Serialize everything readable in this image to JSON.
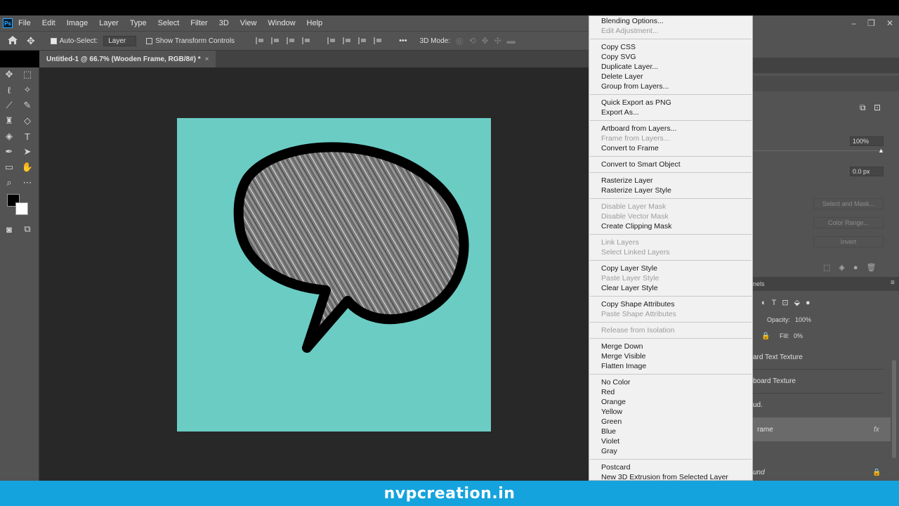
{
  "app": {
    "logo": "Ps"
  },
  "menu": [
    "File",
    "Edit",
    "Image",
    "Layer",
    "Type",
    "Select",
    "Filter",
    "3D",
    "View",
    "Window",
    "Help"
  ],
  "options": {
    "auto_select_label": "Auto-Select:",
    "auto_select_value": "Layer",
    "transform_label": "Show Transform Controls",
    "mode_3d_label": "3D Mode:",
    "more": "•••"
  },
  "document": {
    "tab_title": "Untitled-1 @ 66.7% (Wooden Frame, RGB/8#) *",
    "close": "×",
    "canvas_color": "#6bccc4"
  },
  "properties": {
    "density": "100%",
    "feather": "0.0 px",
    "select_mask_btn": "Select and Mask...",
    "color_range_btn": "Color Range...",
    "invert_btn": "Invert"
  },
  "layers": {
    "panel_title": "nels",
    "opacity_label": "Opacity:",
    "opacity_value": "100%",
    "fill_label": "Fill:",
    "fill_value": "0%",
    "rows": [
      {
        "name": "ard Text Texture"
      },
      {
        "name": "board Texture"
      },
      {
        "name": "ud."
      },
      {
        "name": "rame",
        "fx": "fx"
      },
      {
        "name": "und"
      }
    ]
  },
  "context_menu": {
    "items": [
      {
        "label": "Blending Options...",
        "disabled": false
      },
      {
        "label": "Edit Adjustment...",
        "disabled": true
      },
      {
        "sep": true
      },
      {
        "label": "Copy CSS",
        "disabled": false
      },
      {
        "label": "Copy SVG",
        "disabled": false
      },
      {
        "label": "Duplicate Layer...",
        "disabled": false
      },
      {
        "label": "Delete Layer",
        "disabled": false
      },
      {
        "label": "Group from Layers...",
        "disabled": false
      },
      {
        "sep": true
      },
      {
        "label": "Quick Export as PNG",
        "disabled": false
      },
      {
        "label": "Export As...",
        "disabled": false
      },
      {
        "sep": true
      },
      {
        "label": "Artboard from Layers...",
        "disabled": false
      },
      {
        "label": "Frame from Layers...",
        "disabled": true
      },
      {
        "label": "Convert to Frame",
        "disabled": false
      },
      {
        "sep": true
      },
      {
        "label": "Convert to Smart Object",
        "disabled": false
      },
      {
        "sep": true
      },
      {
        "label": "Rasterize Layer",
        "disabled": false
      },
      {
        "label": "Rasterize Layer Style",
        "disabled": false
      },
      {
        "sep": true
      },
      {
        "label": "Disable Layer Mask",
        "disabled": true
      },
      {
        "label": "Disable Vector Mask",
        "disabled": true
      },
      {
        "label": "Create Clipping Mask",
        "disabled": false
      },
      {
        "sep": true
      },
      {
        "label": "Link Layers",
        "disabled": true
      },
      {
        "label": "Select Linked Layers",
        "disabled": true
      },
      {
        "sep": true
      },
      {
        "label": "Copy Layer Style",
        "disabled": false
      },
      {
        "label": "Paste Layer Style",
        "disabled": true
      },
      {
        "label": "Clear Layer Style",
        "disabled": false
      },
      {
        "sep": true
      },
      {
        "label": "Copy Shape Attributes",
        "disabled": false
      },
      {
        "label": "Paste Shape Attributes",
        "disabled": true
      },
      {
        "sep": true
      },
      {
        "label": "Release from Isolation",
        "disabled": true
      },
      {
        "sep": true
      },
      {
        "label": "Merge Down",
        "disabled": false
      },
      {
        "label": "Merge Visible",
        "disabled": false
      },
      {
        "label": "Flatten Image",
        "disabled": false
      },
      {
        "sep": true
      },
      {
        "label": "No Color",
        "disabled": false
      },
      {
        "label": "Red",
        "disabled": false
      },
      {
        "label": "Orange",
        "disabled": false
      },
      {
        "label": "Yellow",
        "disabled": false
      },
      {
        "label": "Green",
        "disabled": false
      },
      {
        "label": "Blue",
        "disabled": false
      },
      {
        "label": "Violet",
        "disabled": false
      },
      {
        "label": "Gray",
        "disabled": false
      },
      {
        "sep": true
      },
      {
        "label": "Postcard",
        "disabled": false
      },
      {
        "label": "New 3D Extrusion from Selected Layer",
        "disabled": false
      }
    ]
  },
  "footer": {
    "text": "nvpcreation.in",
    "color": "#15a3dd"
  }
}
